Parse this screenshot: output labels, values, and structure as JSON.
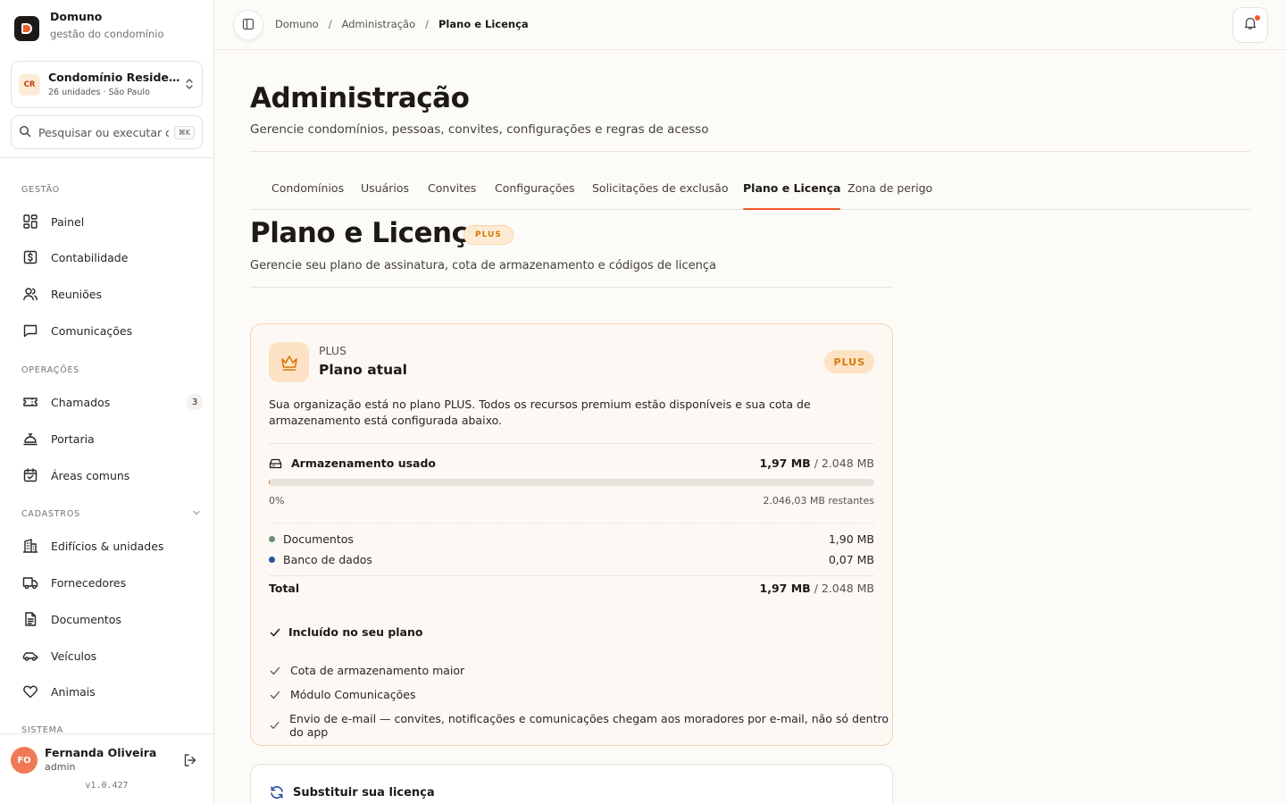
{
  "brand": {
    "name": "Domuno",
    "subtitle": "gestão do condomínio"
  },
  "org": {
    "initials": "CR",
    "name": "Condomínio Residencial",
    "meta": "26 unidades · São Paulo"
  },
  "search": {
    "placeholder": "Pesquisar ou executar comando",
    "shortcut": "⌘K"
  },
  "sidebar": {
    "sections": [
      {
        "label": "GESTÃO"
      },
      {
        "label": "OPERAÇÕES"
      },
      {
        "label": "CADASTROS"
      },
      {
        "label": "SISTEMA"
      }
    ],
    "items": [
      {
        "label": "Painel",
        "icon": "dashboard-icon"
      },
      {
        "label": "Contabilidade",
        "icon": "dollar-icon"
      },
      {
        "label": "Reuniões",
        "icon": "users-icon"
      },
      {
        "label": "Comunicações",
        "icon": "message-icon"
      },
      {
        "label": "Chamados",
        "icon": "ticket-icon",
        "count": "3"
      },
      {
        "label": "Portaria",
        "icon": "bell-concierge-icon"
      },
      {
        "label": "Áreas comuns",
        "icon": "calendar-check-icon"
      },
      {
        "label": "Edifícios & unidades",
        "icon": "building-icon"
      },
      {
        "label": "Fornecedores",
        "icon": "truck-icon"
      },
      {
        "label": "Documentos",
        "icon": "document-icon"
      },
      {
        "label": "Veículos",
        "icon": "car-icon"
      },
      {
        "label": "Animais",
        "icon": "heart-icon"
      }
    ]
  },
  "user": {
    "initials": "FO",
    "name": "Fernanda Oliveira",
    "role": "admin",
    "version": "v1.0.427"
  },
  "breadcrumb": {
    "items": [
      "Domuno",
      "Administração"
    ],
    "current": "Plano e Licença"
  },
  "page": {
    "title": "Administração",
    "subtitle": "Gerencie condomínios, pessoas, convites, configurações e regras de acesso"
  },
  "tabs": [
    {
      "label": "Condomínios"
    },
    {
      "label": "Usuários"
    },
    {
      "label": "Convites"
    },
    {
      "label": "Configurações"
    },
    {
      "label": "Solicitações de exclusão"
    },
    {
      "label": "Plano e Licença",
      "active": true
    },
    {
      "label": "Zona de perigo"
    }
  ],
  "section": {
    "title": "Plano e Licença",
    "badge": "PLUS",
    "subtitle": "Gerencie seu plano de assinatura, cota de armazenamento e códigos de licença"
  },
  "plan_card": {
    "eyebrow": "PLUS",
    "title": "Plano atual",
    "badge": "PLUS",
    "description": "Sua organização está no plano PLUS. Todos os recursos premium estão disponíveis e sua cota de armazenamento está configurada abaixo.",
    "storage": {
      "label": "Armazenamento usado",
      "used": "1,97 MB",
      "quota": "/ 2.048 MB",
      "percent_label": "0%",
      "fill_fraction": 0.00096,
      "remaining": "2.046,03 MB restantes",
      "breakdown": [
        {
          "label": "Documentos",
          "value": "1,90 MB",
          "color": "#6b8f71"
        },
        {
          "label": "Banco de dados",
          "value": "0,07 MB",
          "color": "#2f4fa3"
        }
      ],
      "total_label": "Total",
      "total_used": "1,97 MB",
      "total_quota": "/ 2.048 MB"
    },
    "included_title": "Incluído no seu plano",
    "features": [
      "Cota de armazenamento maior",
      "Módulo Comunicações",
      "Envio de e-mail — convites, notificações e comunicações chegam aos moradores por e-mail, não só dentro do app"
    ]
  },
  "license_card": {
    "title": "Substituir sua licença"
  },
  "colors": {
    "accent": "#f05a2a",
    "plan_badge": "#d97706"
  }
}
